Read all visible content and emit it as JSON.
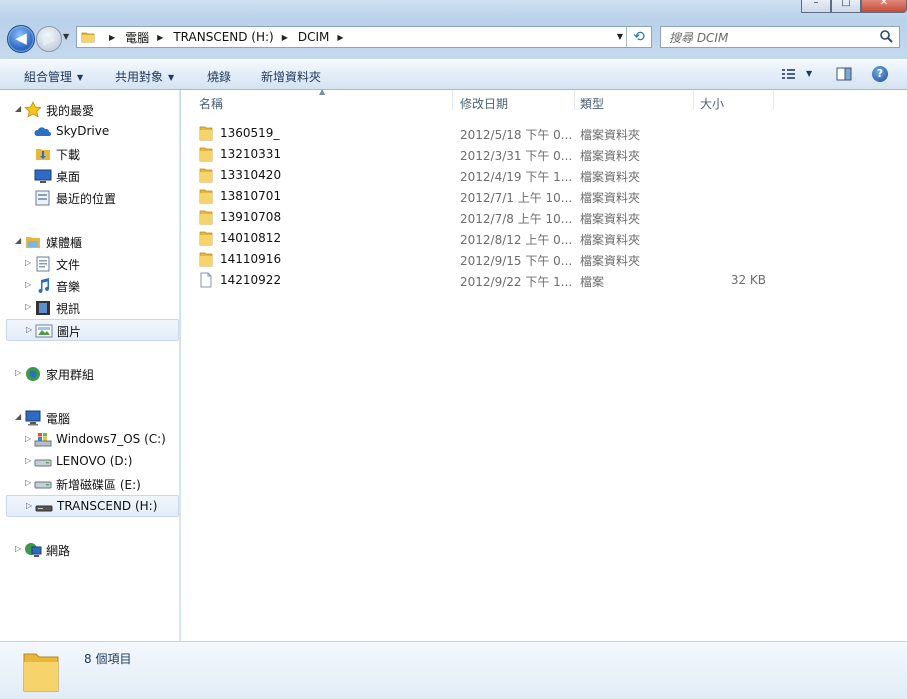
{
  "window": {
    "caption_buttons": {
      "minimize": "–",
      "maximize": "□",
      "close": "✕"
    }
  },
  "navbar": {
    "back_glyph": "◀",
    "forward_glyph": "▶",
    "recent_glyph": "▼",
    "breadcrumb": [
      "電腦",
      "TRANSCEND (H:)",
      "DCIM"
    ],
    "refresh_glyph": "⟲",
    "search_placeholder": "搜尋 DCIM"
  },
  "toolbar": {
    "organize": "組合管理",
    "share": "共用對象",
    "burn": "燒錄",
    "new_folder": "新增資料夾"
  },
  "nav_pane": {
    "favorites": {
      "label": "我的最愛",
      "items": [
        "SkyDrive",
        "下載",
        "桌面",
        "最近的位置"
      ]
    },
    "libraries": {
      "label": "媒體櫃",
      "items": [
        "文件",
        "音樂",
        "視訊",
        "圖片"
      ]
    },
    "homegroup": {
      "label": "家用群組"
    },
    "computer": {
      "label": "電腦",
      "items": [
        "Windows7_OS (C:)",
        "LENOVO (D:)",
        "新增磁碟區 (E:)",
        "TRANSCEND (H:)"
      ]
    },
    "network": {
      "label": "網路"
    }
  },
  "columns": {
    "name": "名稱",
    "date": "修改日期",
    "type": "類型",
    "size": "大小"
  },
  "files": [
    {
      "name": "1360519_",
      "date": "2012/5/18 下午 0...",
      "type": "檔案資料夾",
      "size": "",
      "icon": "folder-icon"
    },
    {
      "name": "13210331",
      "date": "2012/3/31 下午 0...",
      "type": "檔案資料夾",
      "size": "",
      "icon": "folder-icon"
    },
    {
      "name": "13310420",
      "date": "2012/4/19 下午 1...",
      "type": "檔案資料夾",
      "size": "",
      "icon": "folder-icon"
    },
    {
      "name": "13810701",
      "date": "2012/7/1 上午 10...",
      "type": "檔案資料夾",
      "size": "",
      "icon": "folder-icon"
    },
    {
      "name": "13910708",
      "date": "2012/7/8 上午 10...",
      "type": "檔案資料夾",
      "size": "",
      "icon": "folder-icon"
    },
    {
      "name": "14010812",
      "date": "2012/8/12 上午 0...",
      "type": "檔案資料夾",
      "size": "",
      "icon": "folder-icon"
    },
    {
      "name": "14110916",
      "date": "2012/9/15 下午 0...",
      "type": "檔案資料夾",
      "size": "",
      "icon": "folder-icon"
    },
    {
      "name": "14210922",
      "date": "2012/9/22 下午 1...",
      "type": "檔案",
      "size": "32 KB",
      "icon": "file-icon"
    }
  ],
  "details": {
    "count": "8 個項目"
  },
  "colors": {
    "accent": "#1e395b",
    "selection": "#e3edf8",
    "folder": "#f2c94c"
  }
}
